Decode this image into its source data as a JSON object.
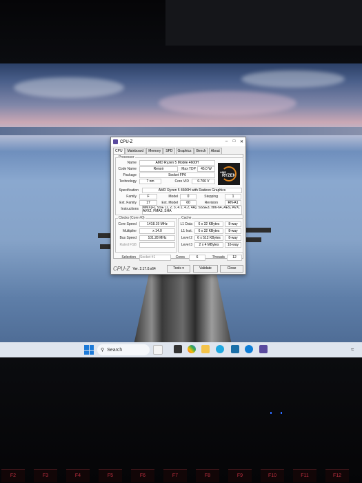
{
  "window": {
    "title": "CPU-Z",
    "tabs": [
      "CPU",
      "Mainboard",
      "Memory",
      "SPD",
      "Graphics",
      "Bench",
      "About"
    ],
    "active_tab": "CPU"
  },
  "processor": {
    "section": "Processor",
    "name_label": "Name",
    "name": "AMD Ryzen 5 Mobile 4600H",
    "code_name_label": "Code Name",
    "code_name": "Renoir",
    "max_tdp_label": "Max TDP",
    "max_tdp": "45.0 W",
    "package_label": "Package",
    "package": "Socket FP6",
    "technology_label": "Technology",
    "technology": "7 nm",
    "core_vid_label": "Core VID",
    "core_vid": "0.706 V",
    "specification_label": "Specification",
    "specification": "AMD Ryzen 5 4600H with Radeon Graphics",
    "family_label": "Family",
    "family": "F",
    "model_label": "Model",
    "model": "0",
    "stepping_label": "Stepping",
    "stepping": "1",
    "ext_family_label": "Ext. Family",
    "ext_family": "17",
    "ext_model_label": "Ext. Model",
    "ext_model": "60",
    "revision_label": "Revision",
    "revision": "RN-A1",
    "instructions_label": "Instructions",
    "instructions": "MMX(+), SSE (1, 2, 3, 4.1, 4.2, 4A), SSSE3, x86-64, AES, AVX, AVX2, FMA3, SHA",
    "logo": {
      "brand": "AMD",
      "text": "RYZEN"
    }
  },
  "clocks": {
    "section": "Clocks (Core #0)",
    "core_speed_label": "Core Speed",
    "core_speed": "1418.19 MHz",
    "multiplier_label": "Multiplier",
    "multiplier": "x 14.0",
    "bus_speed_label": "Bus Speed",
    "bus_speed": "101.28 MHz",
    "rated_fsb_label": "Rated FSB",
    "rated_fsb": ""
  },
  "cache": {
    "section": "Cache",
    "rows": [
      {
        "label": "L1 Data",
        "size": "6 x 32 KBytes",
        "way": "8-way"
      },
      {
        "label": "L1 Inst.",
        "size": "6 x 32 KBytes",
        "way": "8-way"
      },
      {
        "label": "Level 2",
        "size": "6 x 512 KBytes",
        "way": "8-way"
      },
      {
        "label": "Level 3",
        "size": "2 x 4 MBytes",
        "way": "16-way"
      }
    ]
  },
  "selection": {
    "selection_label": "Selection",
    "selection_value": "Socket #1",
    "cores_label": "Cores",
    "cores": "6",
    "threads_label": "Threads",
    "threads": "12"
  },
  "footer": {
    "brand": "CPU-Z",
    "version": "Ver. 2.17.0.x64",
    "tools": "Tools",
    "validate": "Validate",
    "close": "Close"
  },
  "taskbar": {
    "search_placeholder": "Search"
  },
  "keyboard": {
    "fkeys": [
      "F2",
      "F3",
      "F4",
      "F5",
      "F6",
      "F7",
      "F8",
      "F9",
      "F10",
      "F11",
      "F12"
    ]
  },
  "colors": {
    "accent": "#1d7ad8",
    "ryzen_orange": "#e0861f",
    "key_legend": "#c03040"
  }
}
